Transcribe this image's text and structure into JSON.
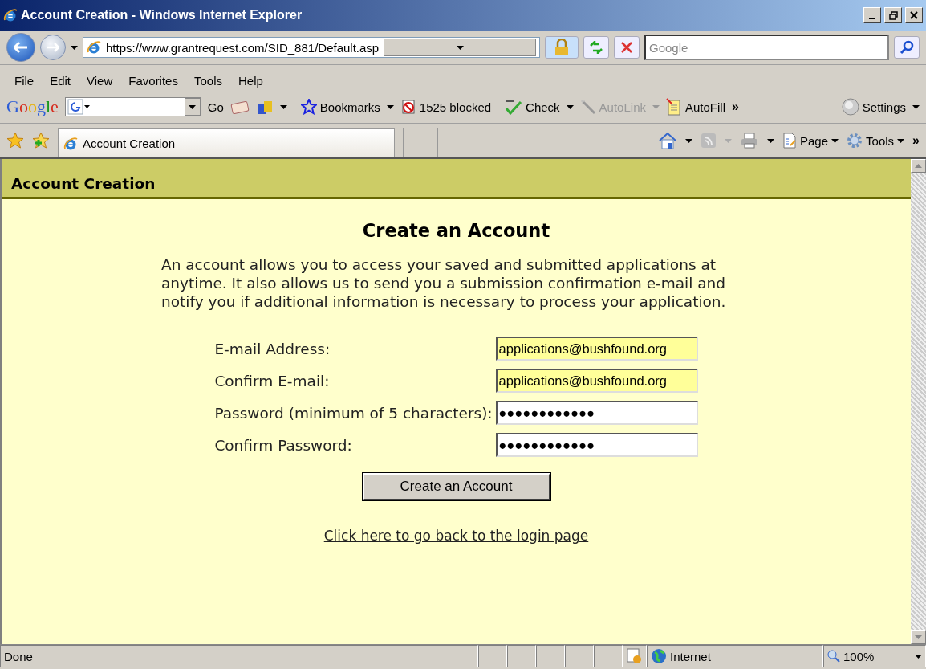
{
  "window": {
    "title": "Account Creation - Windows Internet Explorer"
  },
  "address_bar": {
    "url": "https://www.grantrequest.com/SID_881/Default.asp"
  },
  "search_box": {
    "placeholder": "Google"
  },
  "menu": [
    "File",
    "Edit",
    "View",
    "Favorites",
    "Tools",
    "Help"
  ],
  "google_toolbar": {
    "logo": "Google",
    "go": "Go",
    "more": "»",
    "items": [
      {
        "kind": "bookmarks",
        "label": "Bookmarks",
        "disabled": false
      },
      {
        "kind": "blocked",
        "label": "1525 blocked",
        "disabled": false
      },
      {
        "kind": "check",
        "label": "Check",
        "disabled": false
      },
      {
        "kind": "autolink",
        "label": "AutoLink",
        "disabled": true
      },
      {
        "kind": "autofill",
        "label": "AutoFill",
        "disabled": false
      }
    ],
    "settings": "Settings"
  },
  "tab_bar": {
    "tabs": [
      {
        "label": "Account Creation",
        "selected": true
      }
    ],
    "commands": [
      {
        "kind": "page",
        "label": "Page"
      },
      {
        "kind": "tools",
        "label": "Tools"
      }
    ],
    "more": "»"
  },
  "page": {
    "header": "Account Creation",
    "heading": "Create an Account",
    "intro": "An account allows you to access your saved and submitted applications at anytime. It also allows us to send you a submission confirmation e-mail and notify you if additional information is necessary to process your application.",
    "fields": [
      {
        "label": "E-mail Address:",
        "value": "applications@bushfound.org",
        "autofilled": true
      },
      {
        "label": "Confirm E-mail:",
        "value": "applications@bushfound.org",
        "autofilled": true
      },
      {
        "label": "Password (minimum of 5 characters):",
        "value": "●●●●●●●●●●●●",
        "autofilled": false
      },
      {
        "label": "Confirm Password:",
        "value": "●●●●●●●●●●●●",
        "autofilled": false
      }
    ],
    "submit": "Create an Account",
    "link": "Click here to go back to the login page"
  },
  "status_bar": {
    "text": "Done",
    "zone": "Internet",
    "zoom": "100%"
  }
}
